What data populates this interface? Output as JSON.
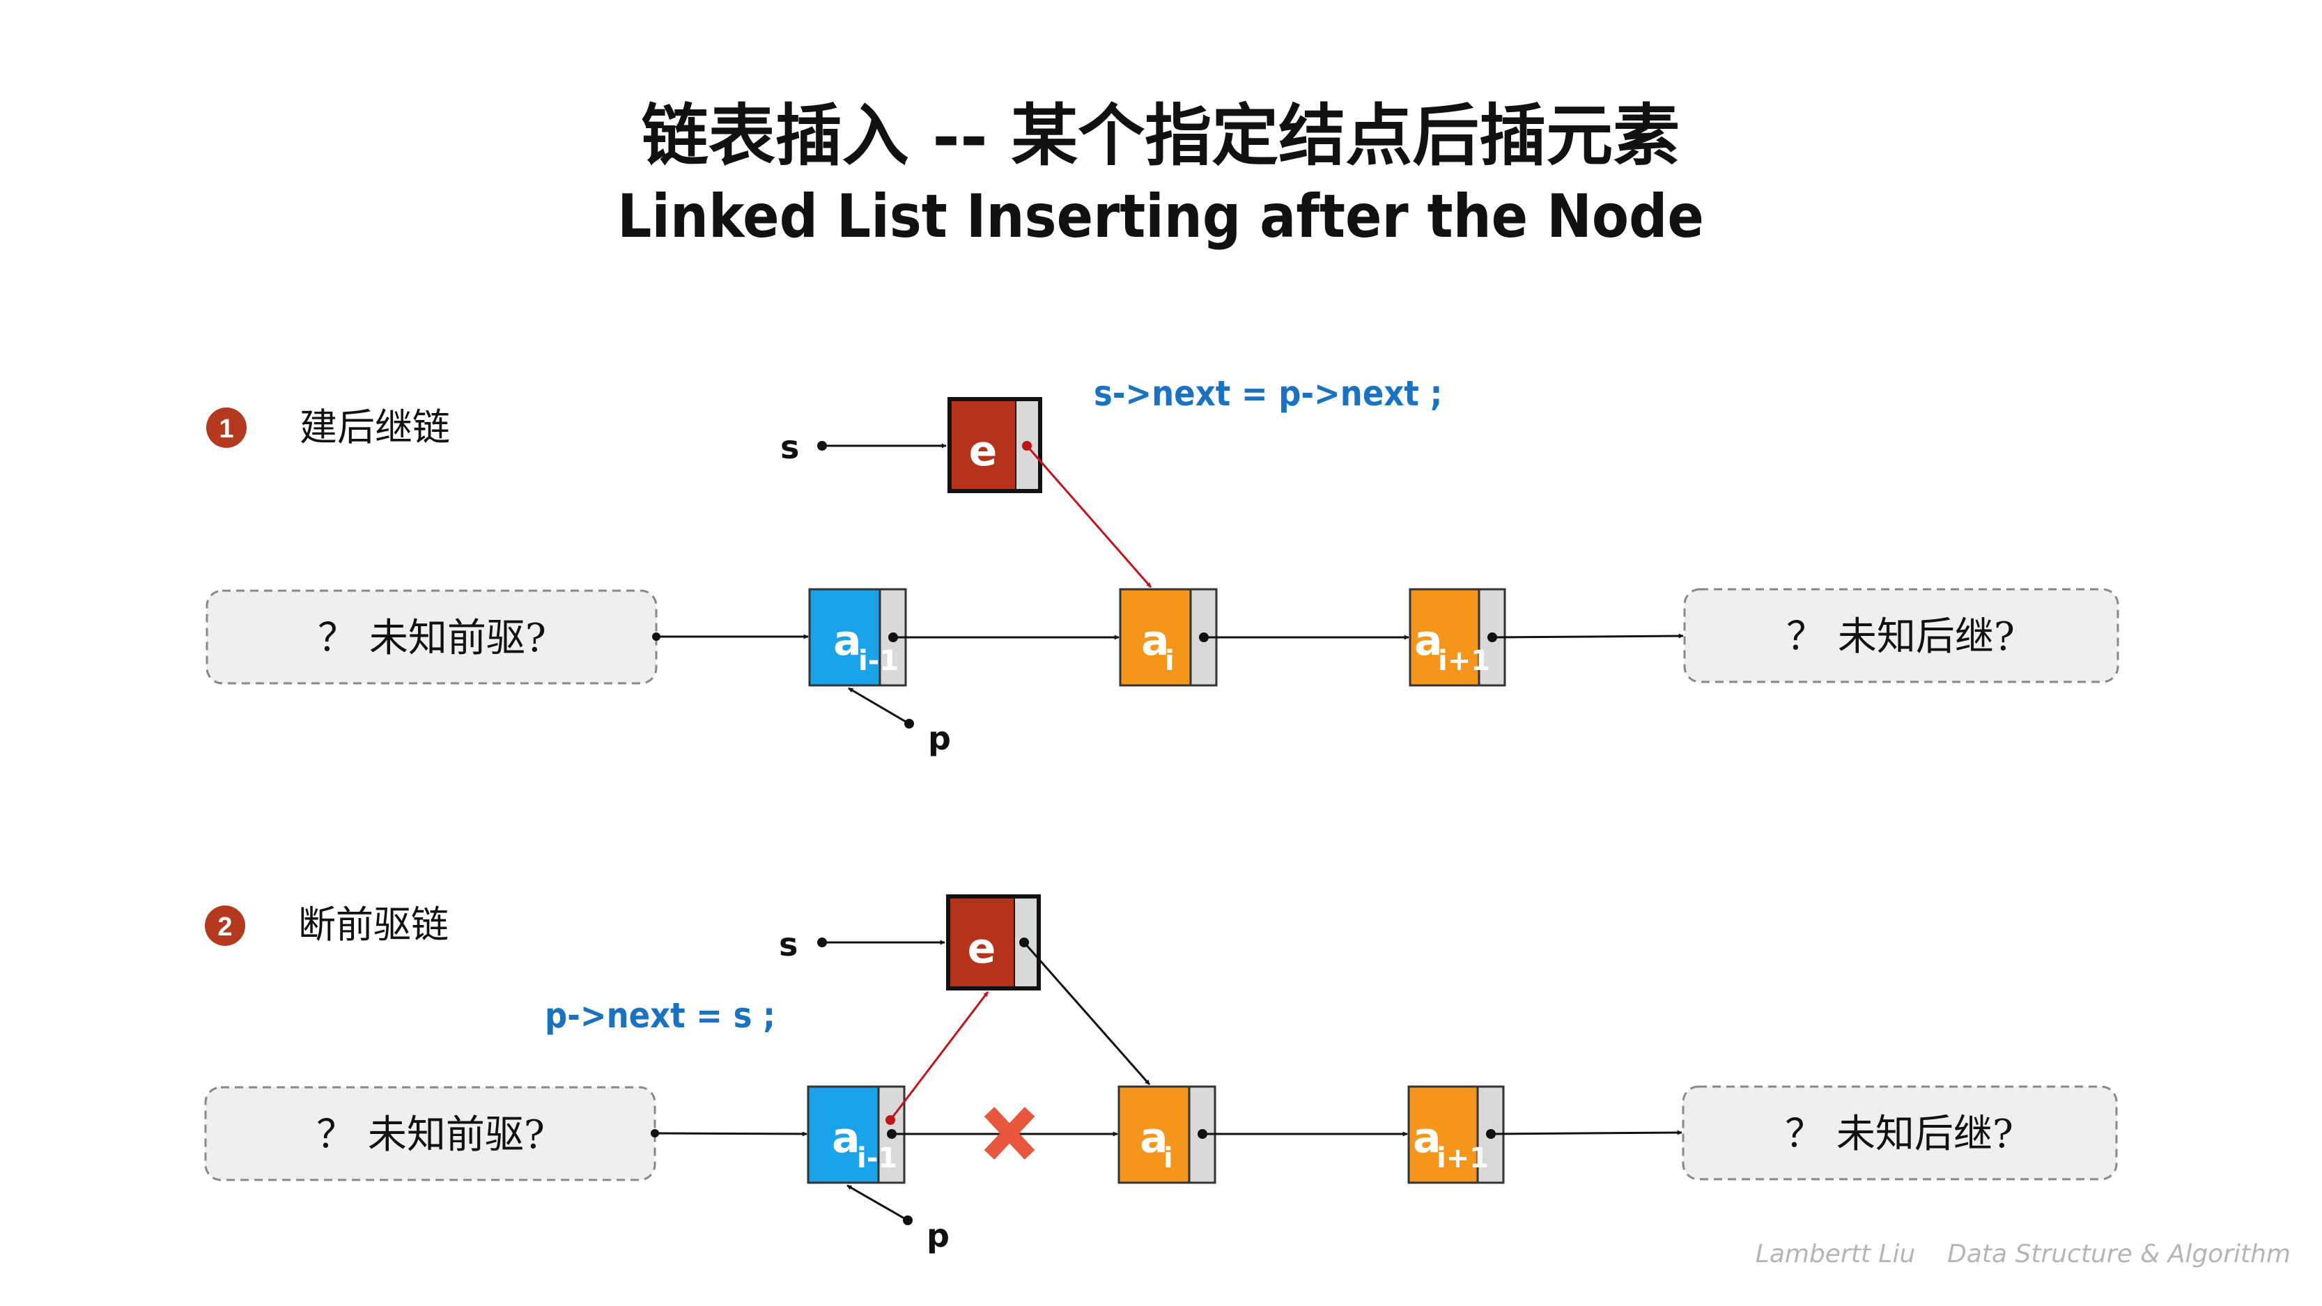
{
  "title": {
    "cn": "链表插入 -- 某个指定结点后插元素",
    "en": "Linked List Inserting after the Node"
  },
  "steps": [
    {
      "number": "1",
      "label": "建后继链",
      "code": "s->next = p->next ;",
      "pointer_s": "s",
      "pointer_p": "p",
      "left_box": "？ 未知前驱?",
      "right_box": "？ 未知后继?",
      "new_node": "e",
      "nodes": [
        {
          "main": "a",
          "sub": "i-1",
          "color": "#1aa3e8"
        },
        {
          "main": "a",
          "sub": "i",
          "color": "#f4961c"
        },
        {
          "main": "a",
          "sub": "i+1",
          "color": "#f4961c"
        }
      ]
    },
    {
      "number": "2",
      "label": "断前驱链",
      "code": "p->next = s ;",
      "pointer_s": "s",
      "pointer_p": "p",
      "left_box": "？ 未知前驱?",
      "right_box": "？ 未知后继?",
      "new_node": "e",
      "nodes": [
        {
          "main": "a",
          "sub": "i-1",
          "color": "#1aa3e8"
        },
        {
          "main": "a",
          "sub": "i",
          "color": "#f4961c"
        },
        {
          "main": "a",
          "sub": "i+1",
          "color": "#f4961c"
        }
      ]
    }
  ],
  "colors": {
    "new_node": "#b5321b",
    "link_new": "#c0141b",
    "code": "#1a72c0",
    "cross": "#e8563e",
    "step_badge": "#b5391e"
  },
  "footer": "Lambertt Liu    Data Structure & Algorithm"
}
